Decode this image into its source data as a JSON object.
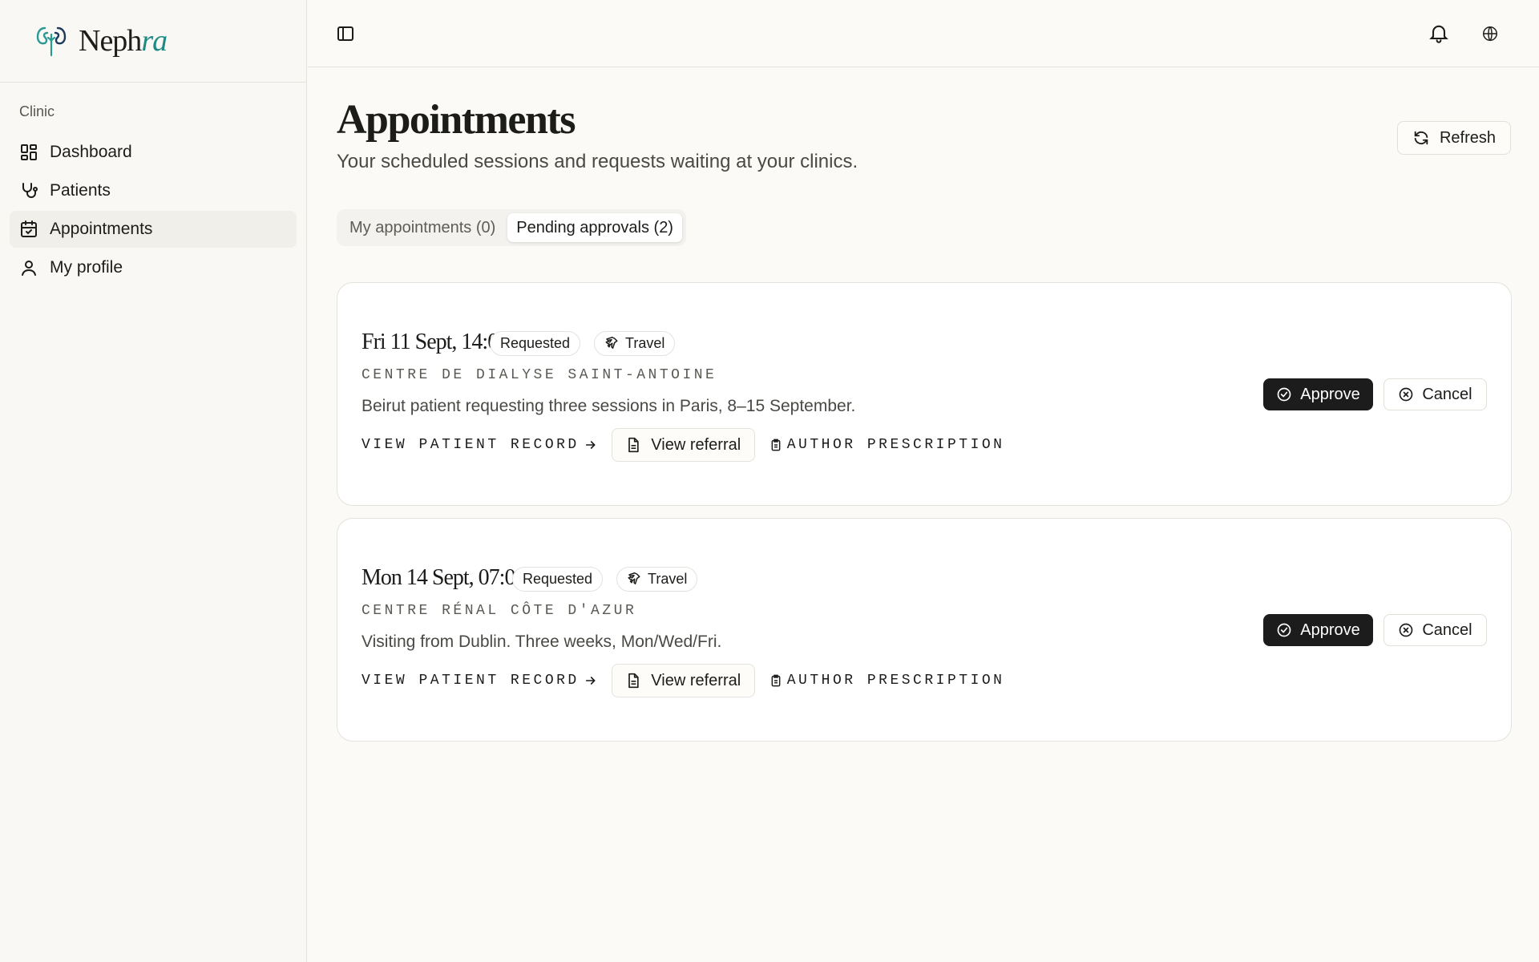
{
  "brand": {
    "name_main": "Neph",
    "name_accent": "ra"
  },
  "sidebar": {
    "section_label": "Clinic",
    "items": [
      {
        "label": "Dashboard",
        "icon": "dashboard-icon"
      },
      {
        "label": "Patients",
        "icon": "stethoscope-icon"
      },
      {
        "label": "Appointments",
        "icon": "calendar-check-icon",
        "active": true
      },
      {
        "label": "My profile",
        "icon": "user-icon"
      }
    ]
  },
  "topbar": {
    "icons": [
      "sidebar-toggle-icon",
      "bell-icon",
      "globe-icon"
    ]
  },
  "page": {
    "title": "Appointments",
    "subtitle": "Your scheduled sessions and requests waiting at your clinics.",
    "refresh_label": "Refresh"
  },
  "tabs": [
    {
      "label": "My appointments (0)",
      "active": false
    },
    {
      "label": "Pending approvals (2)",
      "active": true
    }
  ],
  "appointments": [
    {
      "date": "Fri 11 Sept, 14:00",
      "status": "Requested",
      "type": "Travel",
      "clinic": "CENTRE DE DIALYSE SAINT-ANTOINE",
      "note": "Beirut patient requesting three sessions in Paris, 8–15 September.",
      "view_record_label": "VIEW PATIENT RECORD",
      "view_referral_label": "View referral",
      "author_prescription_label": "AUTHOR PRESCRIPTION",
      "approve_label": "Approve",
      "cancel_label": "Cancel"
    },
    {
      "date": "Mon 14 Sept, 07:00",
      "status": "Requested",
      "type": "Travel",
      "clinic": "CENTRE RÉNAL CÔTE D'AZUR",
      "note": "Visiting from Dublin. Three weeks, Mon/Wed/Fri.",
      "view_record_label": "VIEW PATIENT RECORD",
      "view_referral_label": "View referral",
      "author_prescription_label": "AUTHOR PRESCRIPTION",
      "approve_label": "Approve",
      "cancel_label": "Cancel"
    }
  ],
  "colors": {
    "background": "#fbfaf6",
    "sidebar": "#f9f8f4",
    "brand_accent": "#1e8a84",
    "approve_bg": "#1c1c1c",
    "border": "#e4e2dc"
  }
}
